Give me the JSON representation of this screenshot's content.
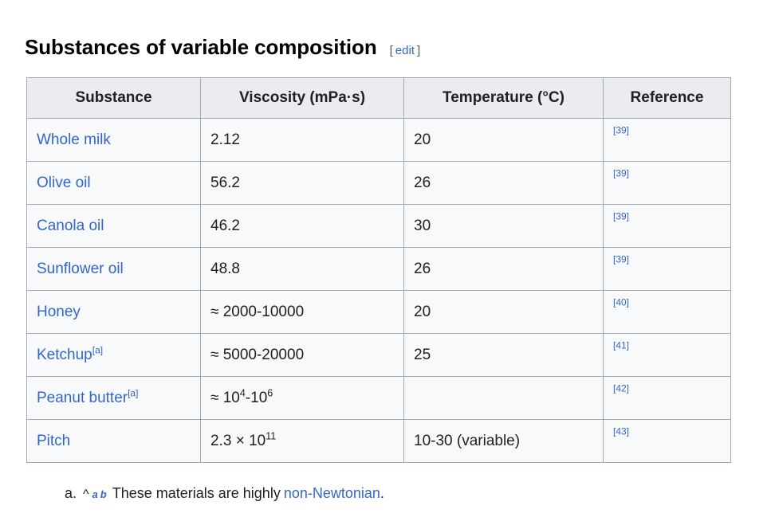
{
  "heading": {
    "title": "Substances of variable composition",
    "edit_open_bracket": "[",
    "edit_label": "edit",
    "edit_close_bracket": "]"
  },
  "table": {
    "columns": [
      "Substance",
      "Viscosity (mPa·s)",
      "Temperature (°C)",
      "Reference"
    ],
    "rows": [
      {
        "substance": "Whole milk",
        "substance_note": "",
        "viscosity_plain": "2.12",
        "temperature": "20",
        "reference": "[39]"
      },
      {
        "substance": "Olive oil",
        "substance_note": "",
        "viscosity_plain": "56.2",
        "temperature": "26",
        "reference": "[39]"
      },
      {
        "substance": "Canola oil",
        "substance_note": "",
        "viscosity_plain": "46.2",
        "temperature": "30",
        "reference": "[39]"
      },
      {
        "substance": "Sunflower oil",
        "substance_note": "",
        "viscosity_plain": "48.8",
        "temperature": "26",
        "reference": "[39]"
      },
      {
        "substance": "Honey",
        "substance_note": "",
        "viscosity_plain": "≈ 2000-10000",
        "temperature": "20",
        "reference": "[40]"
      },
      {
        "substance": "Ketchup",
        "substance_note": "[a]",
        "viscosity_plain": "≈ 5000-20000",
        "temperature": "25",
        "reference": "[41]"
      },
      {
        "substance": "Peanut butter",
        "substance_note": "[a]",
        "viscosity_prefix": "≈ 10",
        "viscosity_exp1": "4",
        "viscosity_mid": "-10",
        "viscosity_exp2": "6",
        "viscosity_plain": "",
        "temperature": "",
        "reference": "[42]"
      },
      {
        "substance": "Pitch",
        "substance_note": "",
        "viscosity_prefix": "2.3 × 10",
        "viscosity_exp1": "11",
        "viscosity_mid": "",
        "viscosity_exp2": "",
        "viscosity_plain": "",
        "temperature": "10-30 (variable)",
        "reference": "[43]"
      }
    ]
  },
  "footnotes": [
    {
      "marker": "a.",
      "caret": "^",
      "backlink_a": "a",
      "backlink_b": "b",
      "text_before": "These materials are highly",
      "link_text": "non-Newtonian",
      "text_after": "."
    }
  ],
  "colors": {
    "link": "#3366cc",
    "text": "#202122",
    "table_border": "#a2a9b1",
    "header_bg": "#eaecf0",
    "cell_bg": "#f8f9fa"
  }
}
